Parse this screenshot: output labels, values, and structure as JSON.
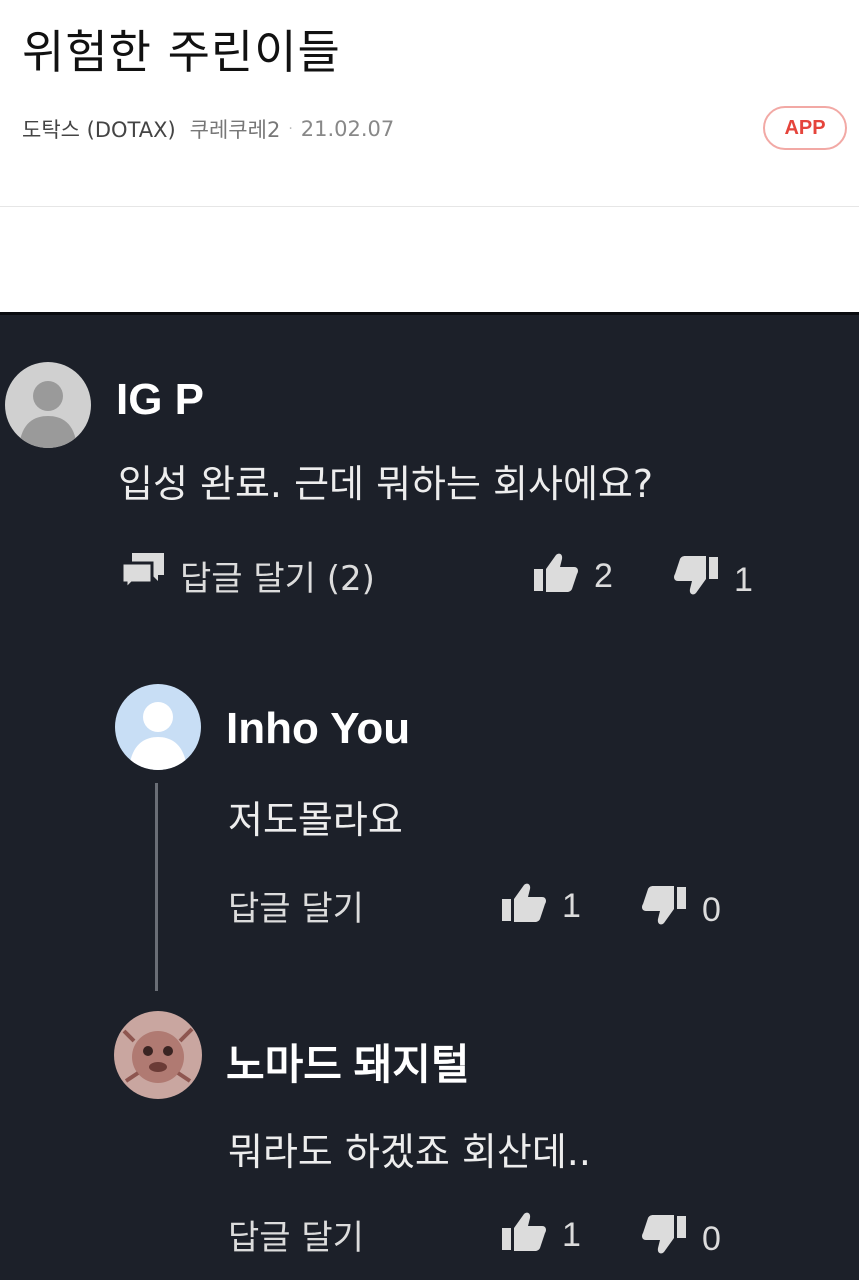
{
  "post": {
    "title": "위험한 주린이들",
    "board": "도탁스 (DOTAX)",
    "author": "쿠레쿠레2",
    "separator": "·",
    "date": "21.02.07",
    "app_badge": "APP"
  },
  "comments": [
    {
      "author": "IG P",
      "text": "입성 완료. 근데 뭐하는 회사에요?",
      "reply_label": "답글 달기 (2)",
      "likes": "2",
      "dislikes": "1"
    },
    {
      "author": "Inho You",
      "text": "저도몰라요",
      "reply_label": "답글 달기",
      "likes": "1",
      "dislikes": "0"
    },
    {
      "author": "노마드 돼지털",
      "text": "뭐라도 하겠죠 회산데..",
      "reply_label": "답글 달기",
      "likes": "1",
      "dislikes": "0"
    }
  ],
  "colors": {
    "screenshot_bg": "#1c2029",
    "badge_red": "#e5443b",
    "avatar_gray": "#cfcfcf",
    "avatar_blue": "#c8def5"
  },
  "icons": [
    "comment-icon",
    "thumbs-up-icon",
    "thumbs-down-icon",
    "default-avatar-icon"
  ]
}
